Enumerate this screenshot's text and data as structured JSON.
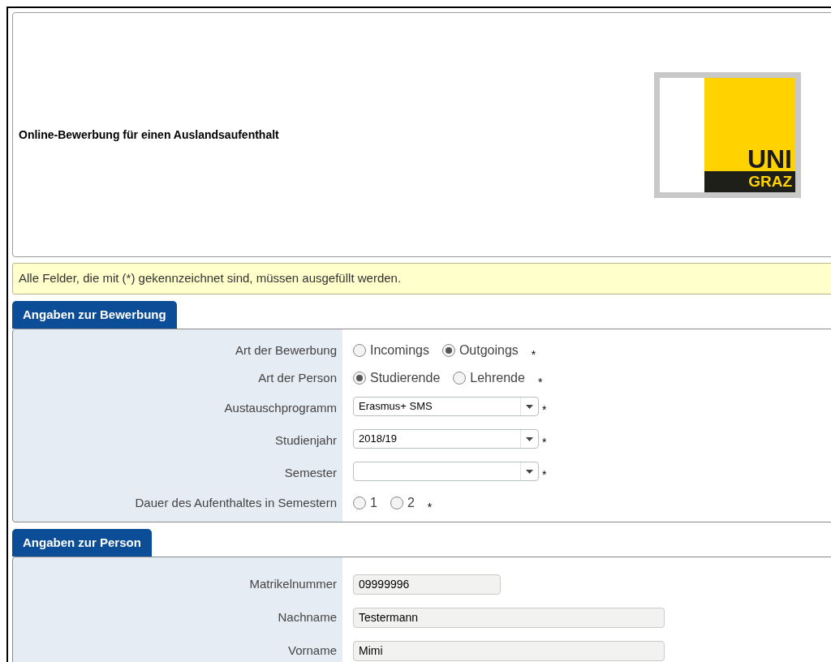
{
  "header": {
    "title": "Online-Bewerbung für einen Auslandsaufenthalt",
    "logo": {
      "top": "UNI",
      "bottom": "GRAZ"
    }
  },
  "notice": "Alle Felder, die mit (*) gekennzeichnet sind, müssen ausgefüllt werden.",
  "sections": [
    {
      "title": "Angaben zur Bewerbung",
      "fields": [
        {
          "label": "Art der Bewerbung",
          "kind": "radio",
          "options": [
            {
              "label": "Incomings",
              "selected": false
            },
            {
              "label": "Outgoings",
              "selected": true
            }
          ],
          "required": "*"
        },
        {
          "label": "Art der Person",
          "kind": "radio",
          "options": [
            {
              "label": "Studierende",
              "selected": true
            },
            {
              "label": "Lehrende",
              "selected": false
            }
          ],
          "required": "*"
        },
        {
          "label": "Austauschprogramm",
          "kind": "select",
          "value": "Erasmus+ SMS",
          "required": "*"
        },
        {
          "label": "Studienjahr",
          "kind": "select",
          "value": "2018/19",
          "required": "*"
        },
        {
          "label": "Semester",
          "kind": "select",
          "required": "*"
        },
        {
          "label": "Dauer des Aufenthaltes in Semestern",
          "kind": "radio",
          "options": [
            {
              "label": "1",
              "selected": false
            },
            {
              "label": "2",
              "selected": false
            }
          ],
          "required": "*"
        }
      ]
    },
    {
      "title": "Angaben zur Person",
      "fields": [
        {
          "label": "Matrikelnummer",
          "kind": "text",
          "value": "09999996"
        },
        {
          "label": "Nachname",
          "kind": "text",
          "value": "Testermann"
        },
        {
          "label": "Vorname",
          "kind": "text",
          "value": "Mimi"
        }
      ]
    }
  ]
}
